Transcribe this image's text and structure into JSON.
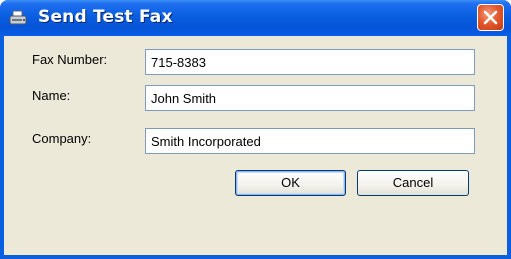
{
  "window": {
    "title": "Send Test Fax",
    "app_icon": "fax-icon",
    "close_icon": "close-icon"
  },
  "form": {
    "fields": [
      {
        "label": "Fax Number:",
        "value": "715-8383"
      },
      {
        "label": "Name:",
        "value": "John Smith"
      },
      {
        "label": "Company:",
        "value": "Smith Incorporated"
      }
    ]
  },
  "buttons": {
    "ok_label": "OK",
    "cancel_label": "Cancel"
  },
  "colors": {
    "titlebar": "#0a5ee0",
    "client_background": "#ece9d8",
    "close_button": "#e45a2f",
    "field_border": "#7f9db9"
  }
}
